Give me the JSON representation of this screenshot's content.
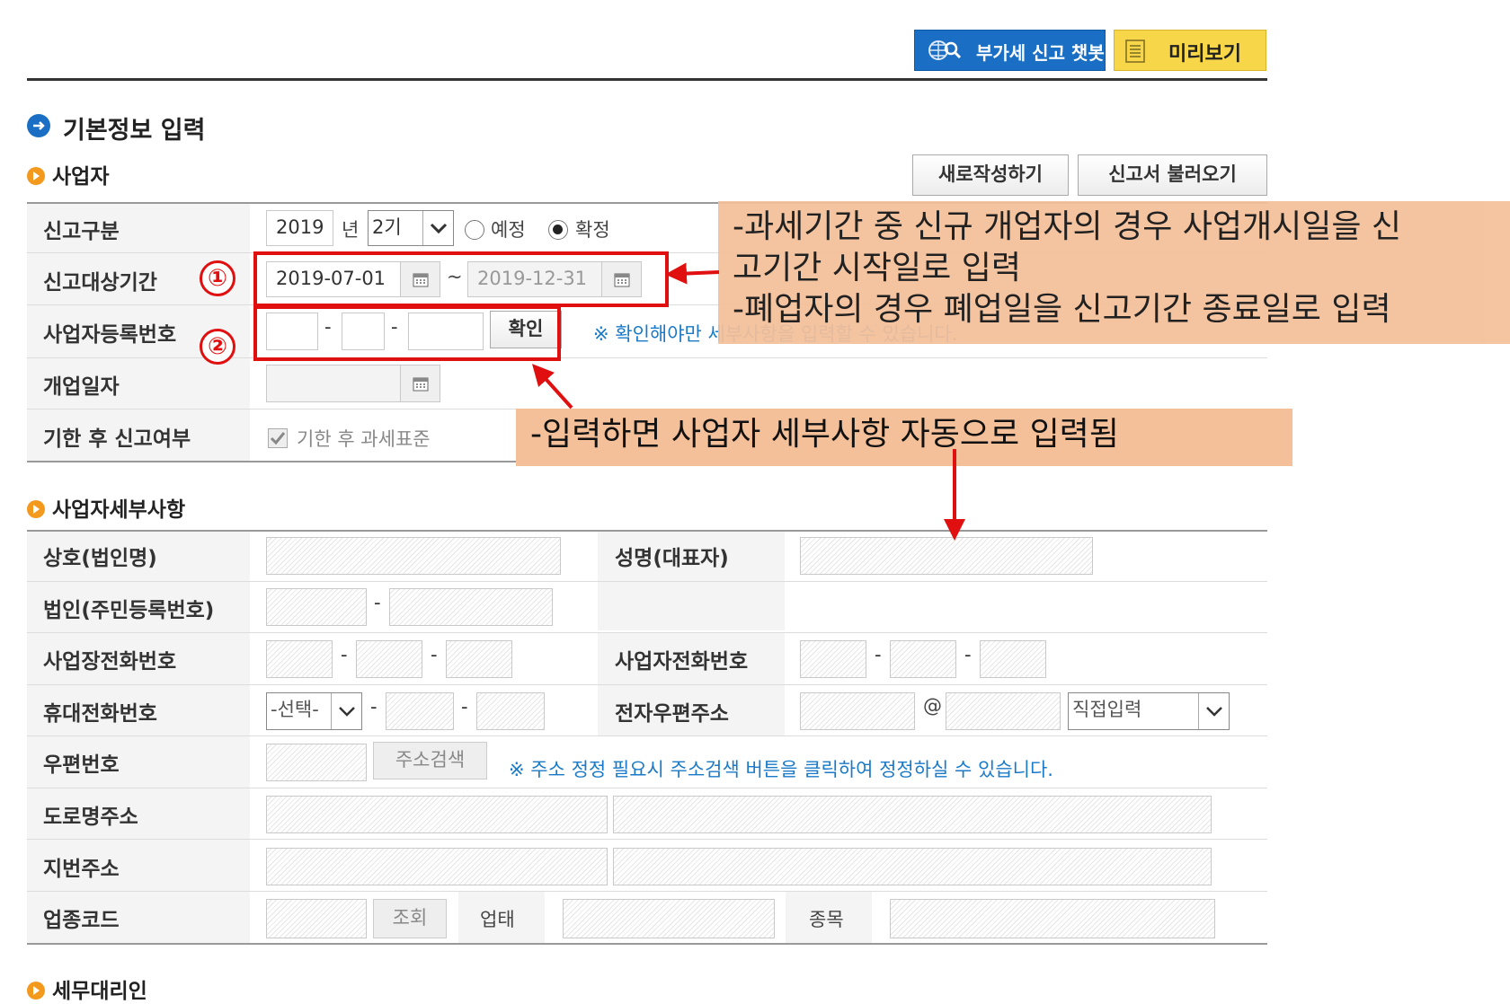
{
  "toolbar": {
    "chatbot_label": "부가세 신고 챗봇",
    "preview_label": "미리보기"
  },
  "page_title": "기본정보 입력",
  "business": {
    "section_title": "사업자",
    "new_button": "새로작성하기",
    "load_button": "신고서 불러오기",
    "labels": {
      "report_type": "신고구분",
      "report_period": "신고대상기간",
      "reg_no": "사업자등록번호",
      "open_date": "개업일자",
      "late_report": "기한 후 신고여부"
    },
    "year_value": "2019",
    "year_unit": "년",
    "term_value": "2기",
    "radio_preliminary": "예정",
    "radio_final": "확정",
    "period_start": "2019-07-01",
    "period_tilde": "~",
    "period_end": "2019-12-31",
    "confirm_button": "확인",
    "reg_notice": "※ 확인해야만 세부사항을 입력할 수 있습니다.",
    "late_checkbox_label": "기한 후 과세표준"
  },
  "details": {
    "section_title": "사업자세부사항",
    "labels": {
      "company_name": "상호(법인명)",
      "representative": "성명(대표자)",
      "corp_reg_no": "법인(주민등록번호)",
      "business_phone": "사업장전화번호",
      "owner_phone": "사업자전화번호",
      "mobile": "휴대전화번호",
      "email": "전자우편주소",
      "zipcode": "우편번호",
      "road_address": "도로명주소",
      "lot_address": "지번주소",
      "industry_code": "업종코드",
      "business_type": "업태",
      "item": "종목"
    },
    "mobile_select": "-선택-",
    "email_at": "@",
    "email_domain_select": "직접입력",
    "address_search_button": "주소검색",
    "address_notice": "※ 주소 정정 필요시 주소검색 버튼을 클릭하여 정정하실 수 있습니다.",
    "lookup_button": "조회"
  },
  "agent": {
    "section_title": "세무대리인"
  },
  "annotations": {
    "marker1": "①",
    "marker2": "②",
    "note1": "-과세기간 중 신규 개업자의 경우 사업개시일을 신\n고기간 시작일로 입력\n-폐업자의 경우 폐업일을 신고기간 종료일로 입력",
    "note2": "-입력하면 사업자 세부사항 자동으로 입력됨"
  },
  "colors": {
    "annotation_bg": "#f4c09a",
    "annotation_red": "#e01010",
    "chatbot_blue": "#1a6fc4",
    "preview_yellow": "#f7d64a",
    "notice_blue": "#1a7ac8"
  }
}
